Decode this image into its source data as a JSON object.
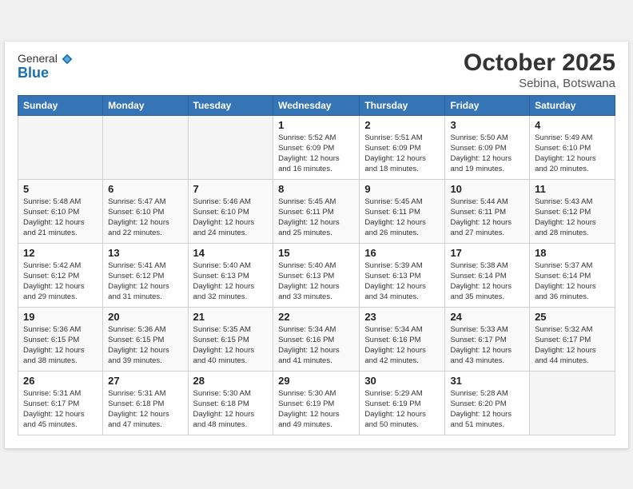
{
  "logo": {
    "general": "General",
    "blue": "Blue"
  },
  "title": "October 2025",
  "location": "Sebina, Botswana",
  "headers": [
    "Sunday",
    "Monday",
    "Tuesday",
    "Wednesday",
    "Thursday",
    "Friday",
    "Saturday"
  ],
  "weeks": [
    [
      {
        "day": "",
        "info": ""
      },
      {
        "day": "",
        "info": ""
      },
      {
        "day": "",
        "info": ""
      },
      {
        "day": "1",
        "info": "Sunrise: 5:52 AM\nSunset: 6:09 PM\nDaylight: 12 hours\nand 16 minutes."
      },
      {
        "day": "2",
        "info": "Sunrise: 5:51 AM\nSunset: 6:09 PM\nDaylight: 12 hours\nand 18 minutes."
      },
      {
        "day": "3",
        "info": "Sunrise: 5:50 AM\nSunset: 6:09 PM\nDaylight: 12 hours\nand 19 minutes."
      },
      {
        "day": "4",
        "info": "Sunrise: 5:49 AM\nSunset: 6:10 PM\nDaylight: 12 hours\nand 20 minutes."
      }
    ],
    [
      {
        "day": "5",
        "info": "Sunrise: 5:48 AM\nSunset: 6:10 PM\nDaylight: 12 hours\nand 21 minutes."
      },
      {
        "day": "6",
        "info": "Sunrise: 5:47 AM\nSunset: 6:10 PM\nDaylight: 12 hours\nand 22 minutes."
      },
      {
        "day": "7",
        "info": "Sunrise: 5:46 AM\nSunset: 6:10 PM\nDaylight: 12 hours\nand 24 minutes."
      },
      {
        "day": "8",
        "info": "Sunrise: 5:45 AM\nSunset: 6:11 PM\nDaylight: 12 hours\nand 25 minutes."
      },
      {
        "day": "9",
        "info": "Sunrise: 5:45 AM\nSunset: 6:11 PM\nDaylight: 12 hours\nand 26 minutes."
      },
      {
        "day": "10",
        "info": "Sunrise: 5:44 AM\nSunset: 6:11 PM\nDaylight: 12 hours\nand 27 minutes."
      },
      {
        "day": "11",
        "info": "Sunrise: 5:43 AM\nSunset: 6:12 PM\nDaylight: 12 hours\nand 28 minutes."
      }
    ],
    [
      {
        "day": "12",
        "info": "Sunrise: 5:42 AM\nSunset: 6:12 PM\nDaylight: 12 hours\nand 29 minutes."
      },
      {
        "day": "13",
        "info": "Sunrise: 5:41 AM\nSunset: 6:12 PM\nDaylight: 12 hours\nand 31 minutes."
      },
      {
        "day": "14",
        "info": "Sunrise: 5:40 AM\nSunset: 6:13 PM\nDaylight: 12 hours\nand 32 minutes."
      },
      {
        "day": "15",
        "info": "Sunrise: 5:40 AM\nSunset: 6:13 PM\nDaylight: 12 hours\nand 33 minutes."
      },
      {
        "day": "16",
        "info": "Sunrise: 5:39 AM\nSunset: 6:13 PM\nDaylight: 12 hours\nand 34 minutes."
      },
      {
        "day": "17",
        "info": "Sunrise: 5:38 AM\nSunset: 6:14 PM\nDaylight: 12 hours\nand 35 minutes."
      },
      {
        "day": "18",
        "info": "Sunrise: 5:37 AM\nSunset: 6:14 PM\nDaylight: 12 hours\nand 36 minutes."
      }
    ],
    [
      {
        "day": "19",
        "info": "Sunrise: 5:36 AM\nSunset: 6:15 PM\nDaylight: 12 hours\nand 38 minutes."
      },
      {
        "day": "20",
        "info": "Sunrise: 5:36 AM\nSunset: 6:15 PM\nDaylight: 12 hours\nand 39 minutes."
      },
      {
        "day": "21",
        "info": "Sunrise: 5:35 AM\nSunset: 6:15 PM\nDaylight: 12 hours\nand 40 minutes."
      },
      {
        "day": "22",
        "info": "Sunrise: 5:34 AM\nSunset: 6:16 PM\nDaylight: 12 hours\nand 41 minutes."
      },
      {
        "day": "23",
        "info": "Sunrise: 5:34 AM\nSunset: 6:16 PM\nDaylight: 12 hours\nand 42 minutes."
      },
      {
        "day": "24",
        "info": "Sunrise: 5:33 AM\nSunset: 6:17 PM\nDaylight: 12 hours\nand 43 minutes."
      },
      {
        "day": "25",
        "info": "Sunrise: 5:32 AM\nSunset: 6:17 PM\nDaylight: 12 hours\nand 44 minutes."
      }
    ],
    [
      {
        "day": "26",
        "info": "Sunrise: 5:31 AM\nSunset: 6:17 PM\nDaylight: 12 hours\nand 45 minutes."
      },
      {
        "day": "27",
        "info": "Sunrise: 5:31 AM\nSunset: 6:18 PM\nDaylight: 12 hours\nand 47 minutes."
      },
      {
        "day": "28",
        "info": "Sunrise: 5:30 AM\nSunset: 6:18 PM\nDaylight: 12 hours\nand 48 minutes."
      },
      {
        "day": "29",
        "info": "Sunrise: 5:30 AM\nSunset: 6:19 PM\nDaylight: 12 hours\nand 49 minutes."
      },
      {
        "day": "30",
        "info": "Sunrise: 5:29 AM\nSunset: 6:19 PM\nDaylight: 12 hours\nand 50 minutes."
      },
      {
        "day": "31",
        "info": "Sunrise: 5:28 AM\nSunset: 6:20 PM\nDaylight: 12 hours\nand 51 minutes."
      },
      {
        "day": "",
        "info": ""
      }
    ]
  ]
}
